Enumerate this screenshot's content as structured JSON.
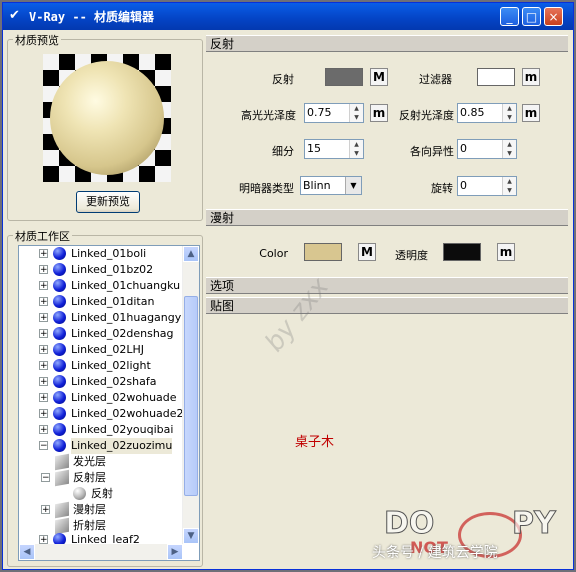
{
  "window": {
    "title": "V-Ray -- 材质编辑器",
    "min": "_",
    "max": "□",
    "close": "×"
  },
  "preview_panel": {
    "label": "材质预览",
    "update_button": "更新预览"
  },
  "workspace": {
    "label": "材质工作区",
    "materials": [
      "Linked_01boli",
      "Linked_01bz02",
      "Linked_01chuangku",
      "Linked_01ditan",
      "Linked_01huagangy",
      "Linked_02denshag",
      "Linked_02LHJ",
      "Linked_02light",
      "Linked_02shafa",
      "Linked_02wohuade",
      "Linked_02wohuade2",
      "Linked_02youqibai",
      "Linked_02zuozimu"
    ],
    "layers": [
      "发光层",
      "反射层",
      "反射",
      "漫射层",
      "折射层"
    ],
    "partial": "Linked_leaf2"
  },
  "reflection": {
    "header": "反射",
    "reflect_label": "反射",
    "filter_label": "过滤器",
    "hilight_gloss_label": "高光光泽度",
    "hilight_gloss": "0.75",
    "refl_gloss_label": "反射光泽度",
    "refl_gloss": "0.85",
    "subdivs_label": "细分",
    "subdivs": "15",
    "aniso_label": "各向异性",
    "aniso": "0",
    "brdf_label": "明暗器类型",
    "brdf": "Blinn",
    "rotation_label": "旋转",
    "rotation": "0",
    "colors": {
      "reflect": "#6b6b6b",
      "filter": "#ffffff"
    }
  },
  "diffuse": {
    "header": "漫射",
    "color_label": "Color",
    "transparency_label": "透明度",
    "colors": {
      "color": "#d8c690",
      "transparency": "#0c0c0c"
    }
  },
  "options": {
    "header": "选项"
  },
  "maps": {
    "header": "贴图"
  },
  "m_letter": "M",
  "m_letter_small": "m",
  "overlay": {
    "watermark": "by zxx",
    "note": "桌子木",
    "stamp_left": "DO",
    "stamp_right": "PY",
    "stamp_bottom": "NOT",
    "credit": "头条号 / 建筑云学院"
  }
}
